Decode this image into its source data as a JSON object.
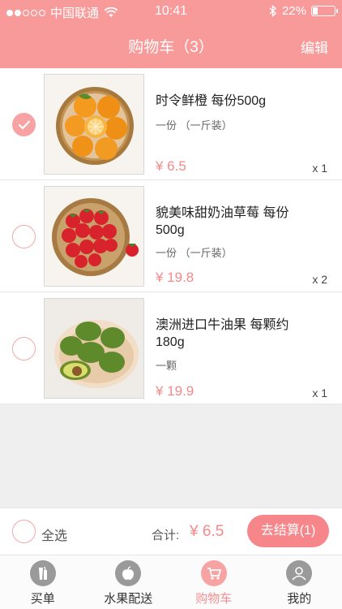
{
  "status_bar": {
    "carrier": "中国联通",
    "time": "10:41",
    "battery": "22%",
    "battery_level": 0.22
  },
  "nav": {
    "title": "购物车（3）",
    "edit": "编辑"
  },
  "items": [
    {
      "name": "时令鲜橙 每份500g",
      "spec": "一份 （一斤装）",
      "price": "¥ 6.5",
      "qty": "x 1",
      "checked": true,
      "image": "orange-basket-photo"
    },
    {
      "name": "貌美味甜奶油草莓 每份500g",
      "spec": "一份 （一斤装）",
      "price": "¥ 19.8",
      "qty": "x 2",
      "checked": false,
      "image": "strawberry-basket-photo"
    },
    {
      "name": "澳洲进口牛油果 每颗约180g",
      "spec": "一颗",
      "price": "¥ 19.9",
      "qty": "x 1",
      "checked": false,
      "image": "avocado-basket-photo"
    }
  ],
  "footer": {
    "select_all": "全选",
    "total_label": "合计:",
    "total_value": "¥ 6.5",
    "checkout": "去结算(1)"
  },
  "tabs": [
    {
      "label": "买单",
      "icon": "drink-icon",
      "active": false
    },
    {
      "label": "水果配送",
      "icon": "apple-icon",
      "active": false
    },
    {
      "label": "购物车",
      "icon": "cart-icon",
      "active": true
    },
    {
      "label": "我的",
      "icon": "user-icon",
      "active": false
    }
  ],
  "colors": {
    "header": "#f99a9a",
    "accent": "#f7868a",
    "price": "#f5898b"
  }
}
